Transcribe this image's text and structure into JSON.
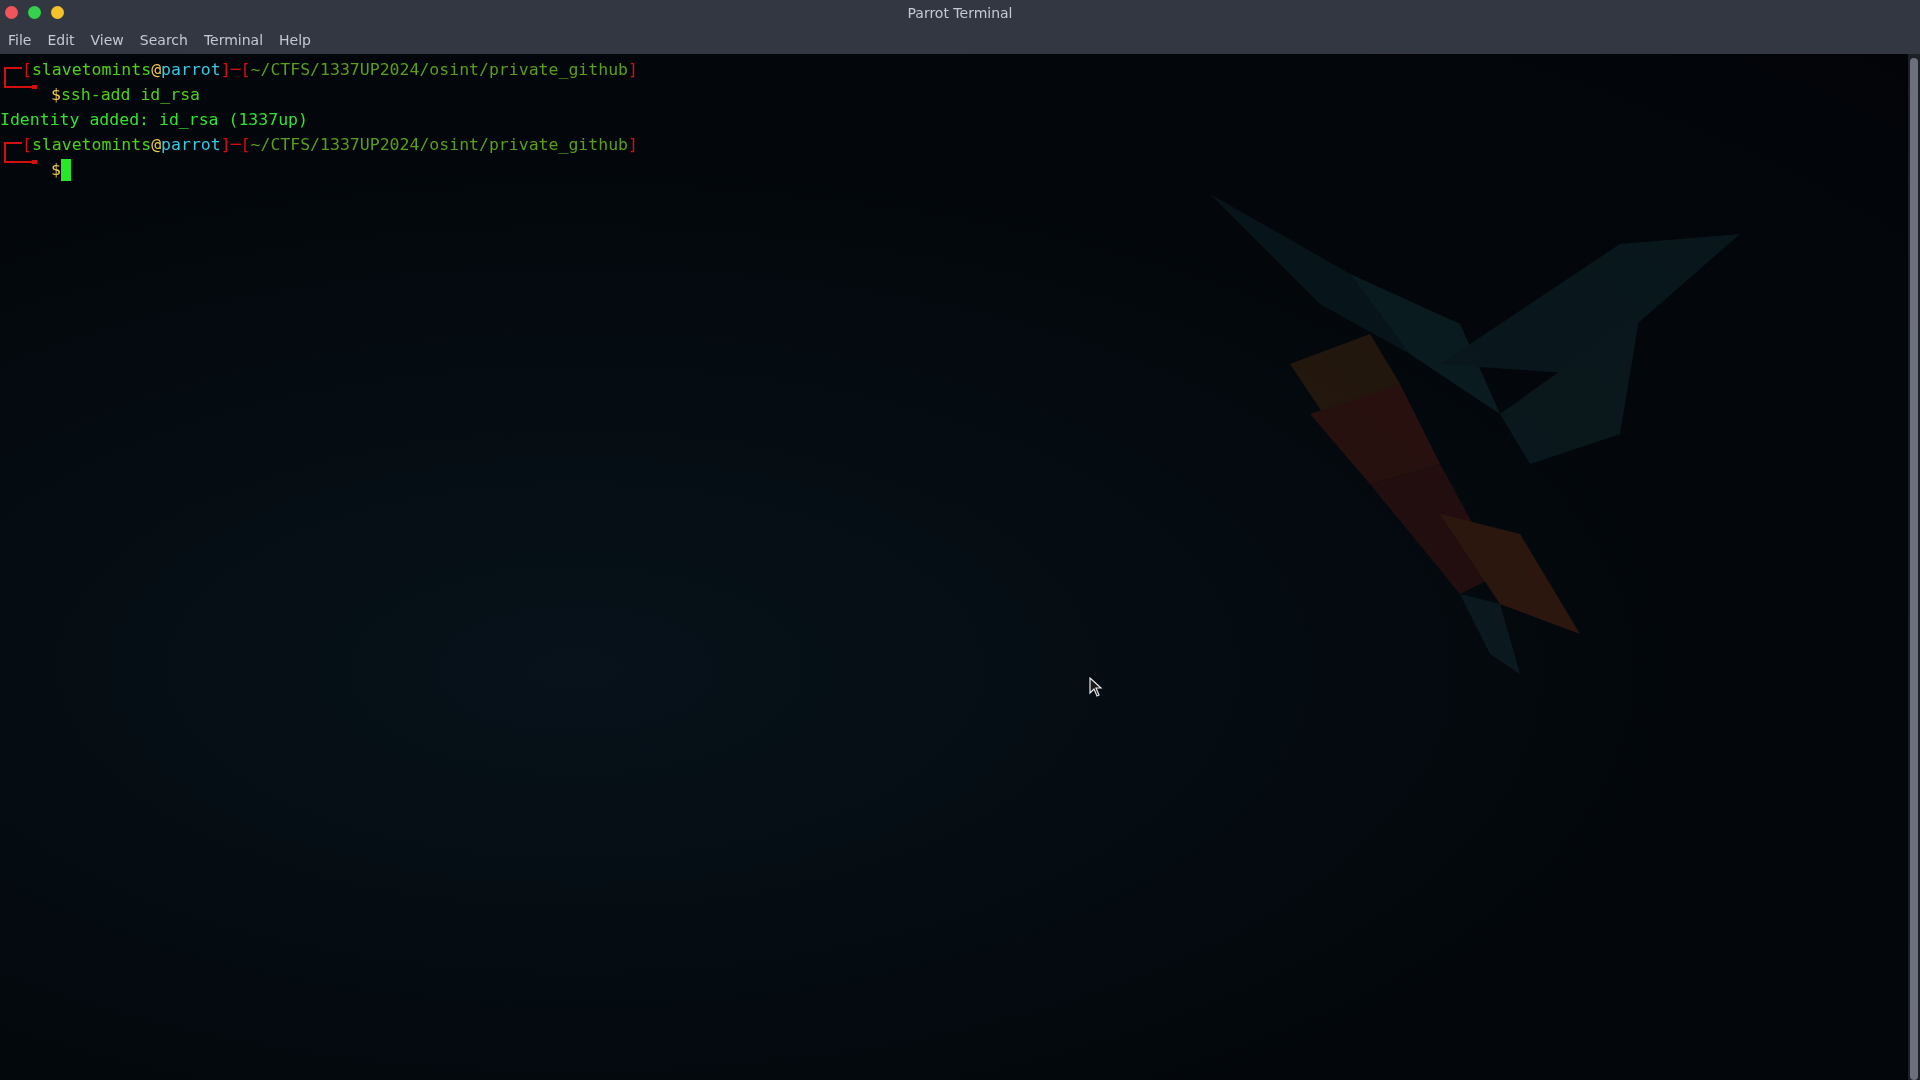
{
  "window": {
    "title": "Parrot Terminal",
    "controls": [
      {
        "kind": "close"
      },
      {
        "kind": "maximize"
      },
      {
        "kind": "minimize"
      }
    ]
  },
  "menu": [
    "File",
    "Edit",
    "View",
    "Search",
    "Terminal",
    "Help"
  ],
  "terminal": {
    "blocks": [
      {
        "kind": "prompt",
        "open": "[",
        "user": "slavetomints",
        "at": "@",
        "host": "parrot",
        "close": "]",
        "joiner": "─",
        "path": "~/CTFS/1337UP2024/osint/private_github",
        "sign": "$",
        "command": "ssh-add id_rsa",
        "cursor": false
      },
      {
        "kind": "output",
        "text": "Identity added: id_rsa (1337up)"
      },
      {
        "kind": "prompt",
        "open": "[",
        "user": "slavetomints",
        "at": "@",
        "host": "parrot",
        "close": "]",
        "joiner": "─",
        "path": "~/CTFS/1337UP2024/osint/private_github",
        "sign": "$",
        "cursor": true
      }
    ]
  }
}
